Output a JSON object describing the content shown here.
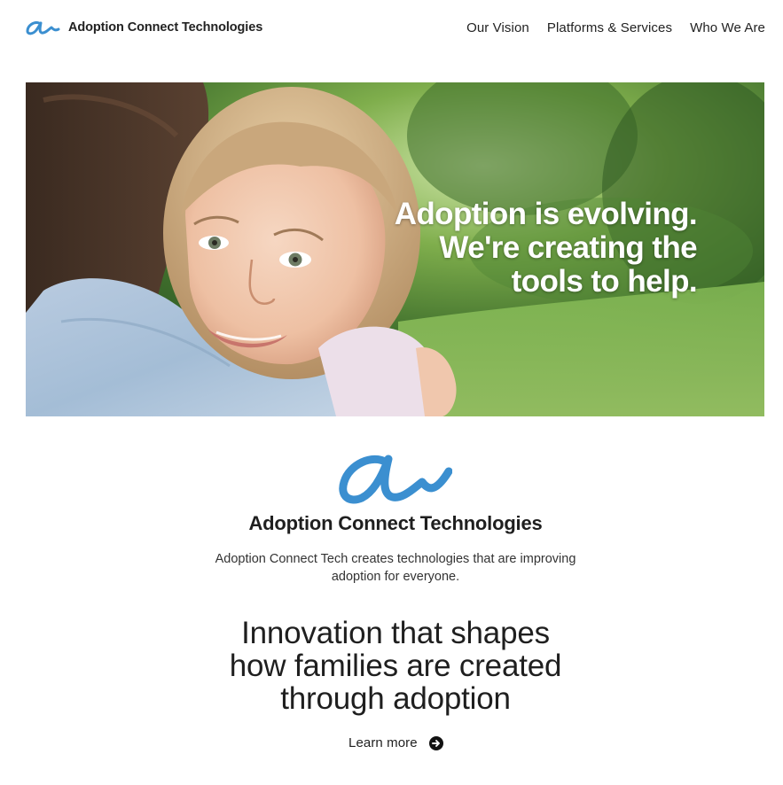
{
  "header": {
    "brand_name": "Adoption Connect Technologies",
    "logo_icon": "script-a-logo-icon",
    "nav": [
      {
        "label": "Our Vision"
      },
      {
        "label": "Platforms & Services"
      },
      {
        "label": "Who We Are"
      }
    ]
  },
  "hero": {
    "headline": [
      "Adoption is evolving.",
      "We're creating the",
      "tools to help."
    ],
    "image_description_icon": "photo-child-hugging-parent"
  },
  "about": {
    "company_name": "Adoption Connect Technologies",
    "description": "Adoption Connect Tech creates technologies that are improving adoption for everyone."
  },
  "tagline": {
    "lines": [
      "Innovation that shapes",
      "how families are created",
      "through adoption"
    ]
  },
  "cta": {
    "label": "Learn more",
    "icon": "arrow-right-circle-icon"
  },
  "colors": {
    "brand_blue": "#3b8fd0",
    "text_dark": "#1f1f1f",
    "hero_text": "#ffffff"
  }
}
